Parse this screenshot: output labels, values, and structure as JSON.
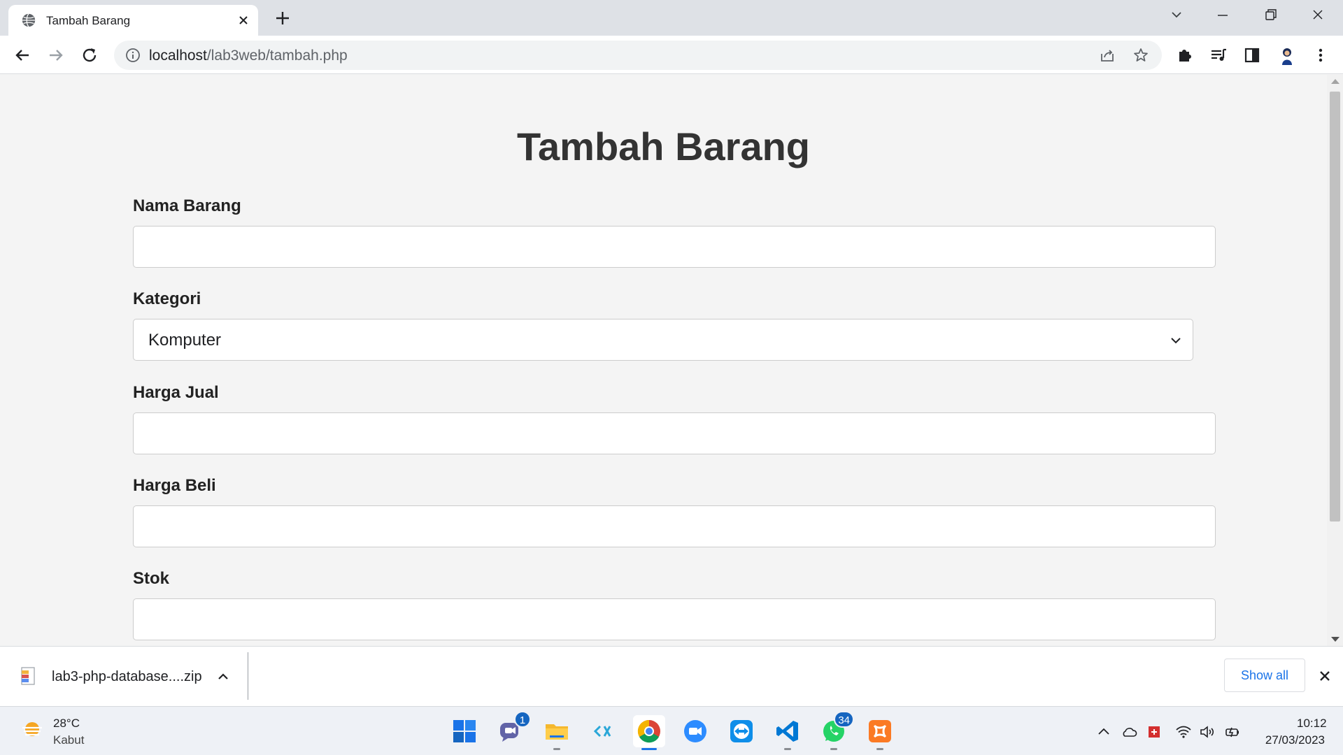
{
  "browser": {
    "tab_title": "Tambah Barang",
    "url_host": "localhost",
    "url_path": "/lab3web/tambah.php"
  },
  "page": {
    "title": "Tambah Barang",
    "fields": {
      "nama_label": "Nama Barang",
      "nama_value": "",
      "kategori_label": "Kategori",
      "kategori_selected": "Komputer",
      "harga_jual_label": "Harga Jual",
      "harga_jual_value": "",
      "harga_beli_label": "Harga Beli",
      "harga_beli_value": "",
      "stok_label": "Stok",
      "stok_value": ""
    }
  },
  "downloads": {
    "file_name": "lab3-php-database....zip",
    "show_all_label": "Show all"
  },
  "taskbar": {
    "weather_temp": "28°C",
    "weather_desc": "Kabut",
    "chat_badge": "1",
    "whatsapp_badge": "34",
    "clock_time": "10:12",
    "clock_date": "27/03/2023"
  },
  "colors": {
    "accent": "#1a73e8",
    "page_bg": "#f4f4f4",
    "title_text": "#333333"
  }
}
